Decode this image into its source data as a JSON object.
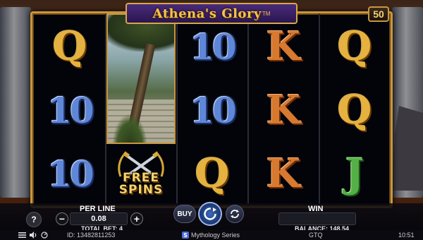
{
  "game": {
    "title": "Athena's Glory",
    "trademark": "TM",
    "lines": "50"
  },
  "reels": {
    "reel1": [
      "Q",
      "10",
      "10"
    ],
    "reel2_wild": "athena-wild",
    "reel2_scatter": [
      "FREE",
      "SPINS"
    ],
    "reel3": [
      "10",
      "10",
      "Q"
    ],
    "reel4": [
      "K",
      "K",
      "K"
    ],
    "reel5": [
      "Q",
      "Q",
      "J"
    ]
  },
  "controls": {
    "help": "?",
    "per_line_label": "PER LINE",
    "minus": "−",
    "bet_per_line": "0.08",
    "plus": "+",
    "buy": "BUY",
    "win_label": "WIN",
    "win_value": ""
  },
  "info": {
    "total_bet": "TOTAL BET: 4",
    "balance": "BALANCE: 148.54"
  },
  "status": {
    "id": "ID: 13482811253",
    "series": "Mythology Series",
    "currency": "GTQ",
    "time": "10:51"
  },
  "colors": {
    "frame_gold": "#c9963c",
    "banner_purple": "#4a2a7a",
    "q_gold": "#e6b23f",
    "ten_blue": "#5f87d8",
    "k_orange": "#d7792e",
    "j_green": "#54b046"
  }
}
